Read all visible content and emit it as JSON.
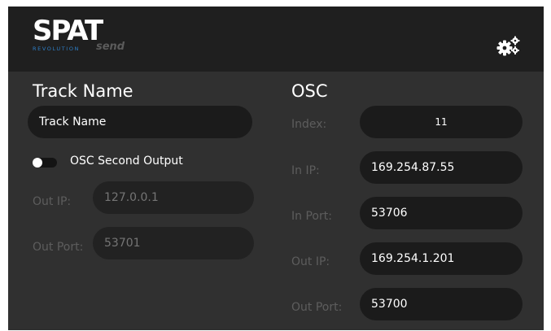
{
  "header": {
    "logo_main": "SPAT",
    "logo_sub": "REVOLUTION",
    "logo_suffix": "send",
    "settings_icon": "gears-icon"
  },
  "track": {
    "title": "Track Name",
    "name_value": "Track Name",
    "second_output_label": "OSC Second Output",
    "second_output_enabled": false,
    "out_ip_label": "Out IP:",
    "out_ip_placeholder": "127.0.0.1",
    "out_port_label": "Out Port:",
    "out_port_placeholder": "53701"
  },
  "osc": {
    "title": "OSC",
    "index_label": "Index:",
    "index_value": "11",
    "in_ip_label": "In IP:",
    "in_ip_value": "169.254.87.55",
    "in_port_label": "In Port:",
    "in_port_value": "53706",
    "out_ip_label": "Out IP:",
    "out_ip_value": "169.254.1.201",
    "out_port_label": "Out Port:",
    "out_port_value": "53700"
  },
  "colors": {
    "background": "#303030",
    "header": "#1f1f1f",
    "field": "#1b1b1b",
    "accent_blue": "#2e7fc8"
  }
}
